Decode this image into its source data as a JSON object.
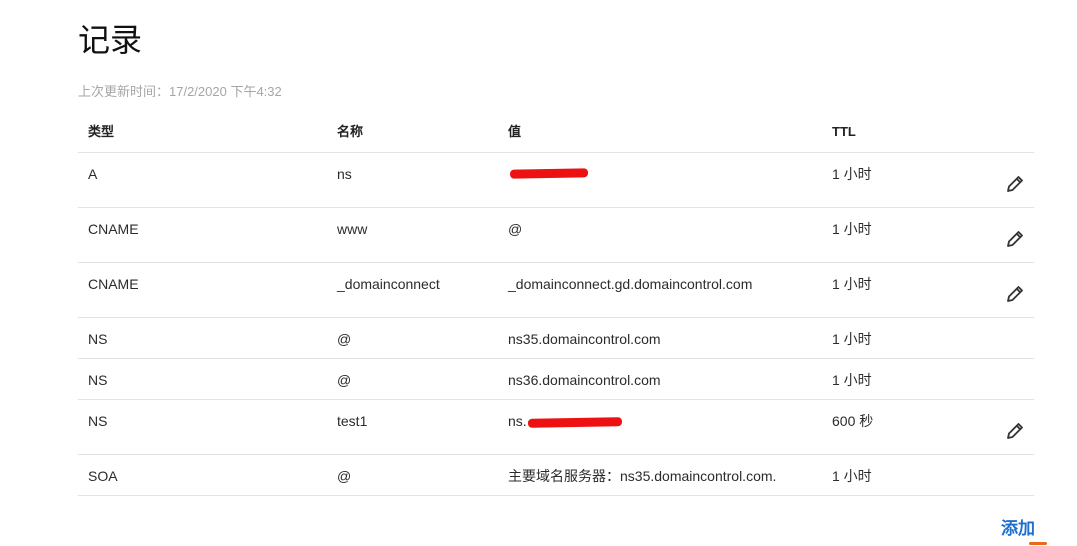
{
  "page": {
    "title": "记录",
    "last_updated": "上次更新时间：17/2/2020 下午4:32"
  },
  "table": {
    "headers": {
      "type": "类型",
      "name": "名称",
      "value": "值",
      "ttl": "TTL"
    },
    "rows": [
      {
        "type": "A",
        "name": "ns",
        "value": "",
        "ttl": "1 小时",
        "editable": true
      },
      {
        "type": "CNAME",
        "name": "www",
        "value": "@",
        "ttl": "1 小时",
        "editable": true
      },
      {
        "type": "CNAME",
        "name": "_domainconnect",
        "value": "_domainconnect.gd.domaincontrol.com",
        "ttl": "1 小时",
        "editable": true
      },
      {
        "type": "NS",
        "name": "@",
        "value": "ns35.domaincontrol.com",
        "ttl": "1 小时",
        "editable": false
      },
      {
        "type": "NS",
        "name": "@",
        "value": "ns36.domaincontrol.com",
        "ttl": "1 小时",
        "editable": false
      },
      {
        "type": "NS",
        "name": "test1",
        "value": "ns.",
        "ttl": "600 秒",
        "editable": true
      },
      {
        "type": "SOA",
        "name": "@",
        "value": "主要域名服务器：ns35.domaincontrol.com.",
        "ttl": "1 小时",
        "editable": false
      }
    ]
  },
  "actions": {
    "add_label": "添加"
  },
  "icons": {
    "edit": "pencil-icon"
  },
  "colors": {
    "accent": "#1f6fd0",
    "muted": "#a6a6a6",
    "divider": "#e3e3e3",
    "redaction": "#ee1111"
  }
}
